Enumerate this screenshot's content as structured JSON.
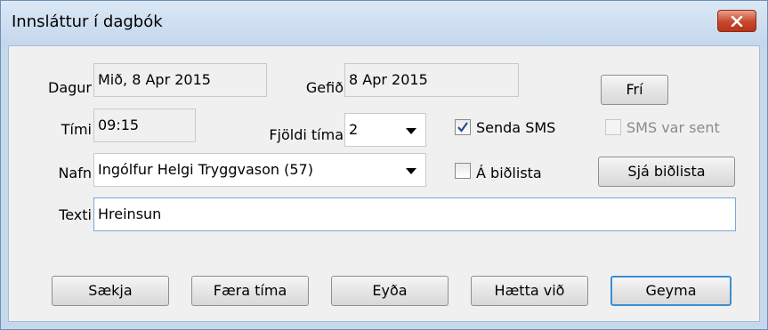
{
  "window": {
    "title": "Innsláttur í dagbók"
  },
  "fields": {
    "dagur_label": "Dagur",
    "dagur_value": "Mið, 8 Apr 2015",
    "gefid_label": "Gefið",
    "gefid_value": "8 Apr 2015",
    "timi_label": "Tími",
    "timi_value": "09:15",
    "fjoldi_label": "Fjöldi tíma",
    "fjoldi_value": "2",
    "nafn_label": "Nafn",
    "nafn_value": "Ingólfur Helgi Tryggvason (57)",
    "texti_label": "Texti",
    "texti_value": "Hreinsun"
  },
  "checkboxes": {
    "senda_sms": {
      "label": "Senda SMS",
      "checked": true
    },
    "sms_var_sent": {
      "label": "SMS var sent",
      "checked": false,
      "disabled": true
    },
    "a_bidlista": {
      "label": "Á biðlista",
      "checked": false
    }
  },
  "buttons": {
    "fri": "Frí",
    "sja_bidlista": "Sjá biðlista",
    "saekja": "Sækja",
    "faera_tima": "Færa tíma",
    "eyda": "Eyða",
    "haetta_vid": "Hætta við",
    "geyma": "Geyma"
  },
  "icons": {
    "close": "close-icon",
    "dropdown": "chevron-down-icon",
    "check": "checkmark-icon"
  },
  "colors": {
    "title_bar": "#c4d7ec",
    "close_button": "#c9472a",
    "default_button_border": "#3c8fd0",
    "check_mark": "#2b4a8a"
  }
}
